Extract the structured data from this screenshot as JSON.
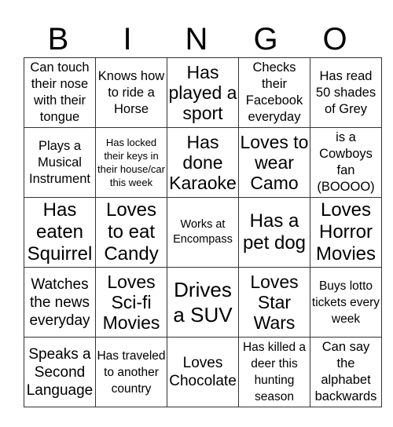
{
  "title": [
    "B",
    "I",
    "N",
    "G",
    "O"
  ],
  "grid": [
    [
      "Can touch their nose with their tongue",
      "Knows how to ride a Horse",
      "Has played a sport",
      "Checks their Facebook everyday",
      "Has read 50 shades of Grey"
    ],
    [
      "Plays a Musical Instrument",
      "Has locked their keys in their house/car this week",
      "Has done Karaoke",
      "Loves to wear Camo",
      "is a Cowboys fan (BOOOO)"
    ],
    [
      "Has eaten Squirrel",
      "Loves to eat Candy",
      "Works at Encompass",
      "Has a pet dog",
      "Loves Horror Movies"
    ],
    [
      "Watches the news everyday",
      "Loves Sci-fi Movies",
      "Drives a SUV",
      "Loves Star Wars",
      "Buys lotto tickets every week"
    ],
    [
      "Speaks a Second Language",
      "Has traveled to another country",
      "Loves Chocolate",
      "Has killed a deer this hunting season",
      "Can say the alphabet backwards"
    ]
  ]
}
